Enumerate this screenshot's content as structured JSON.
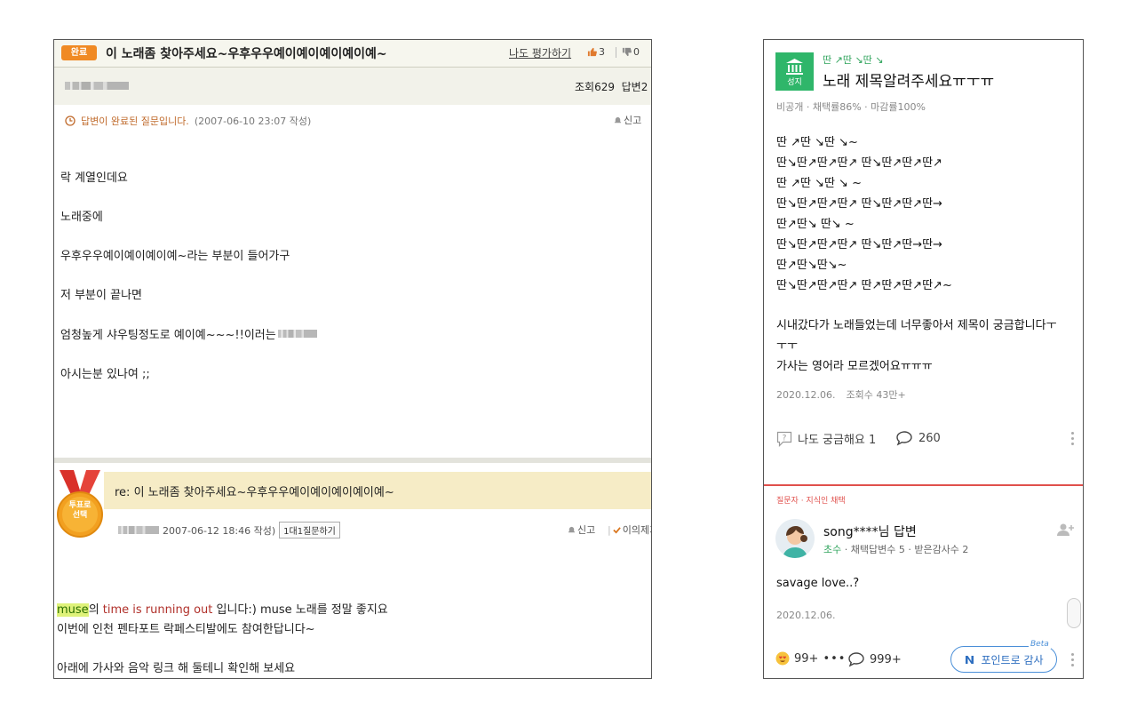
{
  "left": {
    "status_badge": "완료",
    "title": "이 노래좀 찾아주세요~우후우우예이예이예이예이예~",
    "rate_link": "나도 평가하기",
    "thumbs_up": "3",
    "thumbs_down": "0",
    "views": "조회629",
    "answers": "답변2",
    "done_notice": "답변이 완료된 질문입니다.",
    "done_date": "(2007-06-10 23:07 작성)",
    "report": "신고",
    "question_lines": [
      "락 계열인데요",
      "노래중에",
      "우후우우예이예이예이예~라는 부분이 들어가구",
      "저 부분이 끝나면",
      "엄청높게 샤우팅정도로 예이예~~~!!이러는",
      "아시는분 있나여 ;;"
    ],
    "medal_label_1": "투표로",
    "medal_label_2": "선택",
    "answer_title": "re: 이 노래좀 찾아주세요~우후우우예이예이예이예이예~",
    "answer_date": "2007-06-12 18:46 작성)",
    "one_on_one": "1대1질문하기",
    "answer_report": "신고",
    "objection": "이의제기",
    "answer_line1_hl": "muse",
    "answer_line1_a": "의 ",
    "answer_line1_red": "time is running out",
    "answer_line1_b": " 입니다:) muse 노래를 정말 좋지요",
    "answer_line2": "이번에 인천 펜타포트 락페스티발에도 참여한답니다~",
    "answer_line3": "아래에 가사와 음악 링크 해 둘테니 확인해 보세요"
  },
  "right": {
    "logo_caption": "성지",
    "category": "딴 ↗딴 ↘딴 ↘",
    "title": "노래 제목알려주세요ㅠㅜㅠ",
    "stats": "비공개 · 채택률86% · 마감률100%",
    "body_lines": [
      "딴 ↗딴 ↘딴 ↘~",
      "딴↘딴↗딴↗딴↗ 딴↘딴↗딴↗딴↗",
      "딴 ↗딴 ↘딴 ↘ ~",
      "딴↘딴↗딴↗딴↗ 딴↘딴↗딴↗딴→",
      "딴↗딴↘ 딴↘ ~",
      "딴↘딴↗딴↗딴↗ 딴↘딴↗딴→딴→",
      "딴↗딴↘딴↘~",
      "딴↘딴↗딴↗딴↗ 딴↗딴↗딴↗딴↗~",
      "시내갔다가 노래들었는데 너무좋아서 제목이 궁금합니다ㅜ",
      "ㅜㅜ",
      "가사는 영어라 모르겠어요ㅠㅠㅠ"
    ],
    "date": "2020.12.06.",
    "views": "조회수 43만+",
    "curious": "나도 궁금해요 1",
    "comments": "260",
    "selected_label": "질문자 · 지식인 채택",
    "answerer": "song****님 답변",
    "level": "초수",
    "answerer_stats": "· 채택답변수 5 · 받은감사수 2",
    "answer_text": "savage love..?",
    "answer_date": "2020.12.06.",
    "reactions": "99+",
    "answer_comments": "999+",
    "thanks_button": "포인트로 감사",
    "beta": "Beta"
  }
}
